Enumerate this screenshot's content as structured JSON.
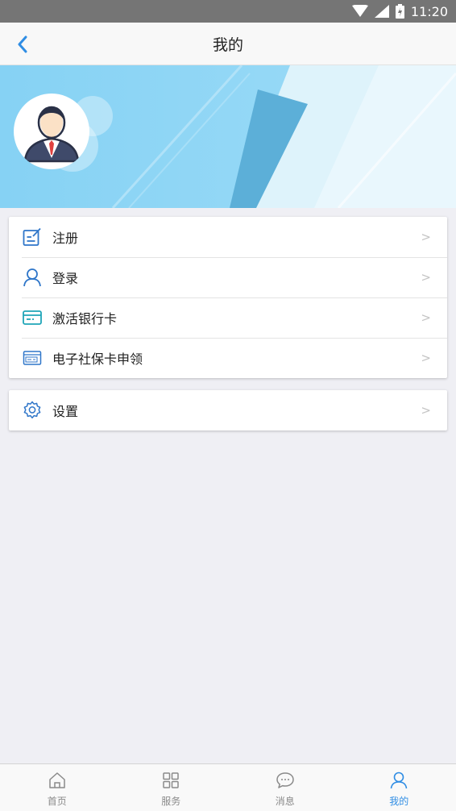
{
  "status_bar": {
    "time": "11:20"
  },
  "nav": {
    "title": "我的"
  },
  "menu_group_1": [
    {
      "label": "注册",
      "icon": "register-icon"
    },
    {
      "label": "登录",
      "icon": "user-icon"
    },
    {
      "label": "激活银行卡",
      "icon": "bank-card-icon"
    },
    {
      "label": "电子社保卡申领",
      "icon": "social-security-card-icon"
    }
  ],
  "menu_group_2": [
    {
      "label": "设置",
      "icon": "gear-icon"
    }
  ],
  "menu_chevron": ">",
  "tabs": [
    {
      "label": "首页",
      "icon": "home-icon",
      "active": false
    },
    {
      "label": "服务",
      "icon": "grid-icon",
      "active": false
    },
    {
      "label": "消息",
      "icon": "message-icon",
      "active": false
    },
    {
      "label": "我的",
      "icon": "user-icon",
      "active": true
    }
  ],
  "colors": {
    "accent": "#2f8de4",
    "banner_light": "#8fd6f6",
    "banner_dark": "#5fb1d9"
  }
}
